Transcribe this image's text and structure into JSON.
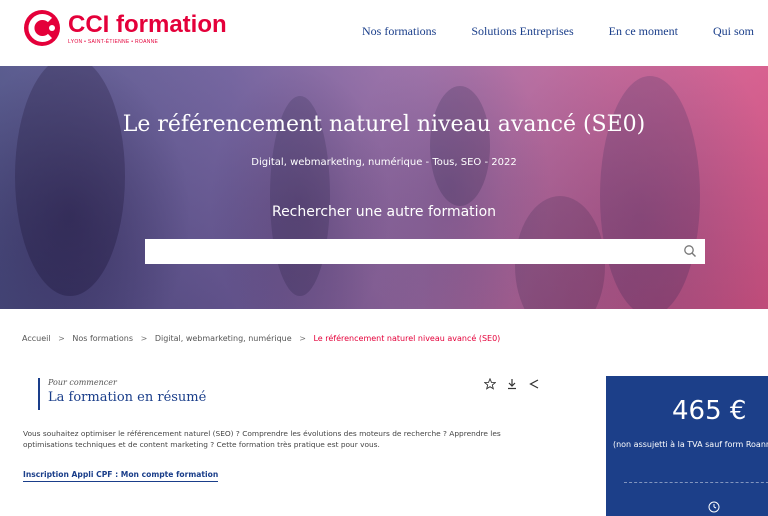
{
  "header": {
    "logo_title": "CCI formation",
    "logo_subtitle": "LYON • SAINT-ÉTIENNE • ROANNE",
    "nav": [
      "Nos formations",
      "Solutions Entreprises",
      "En ce moment",
      "Qui som"
    ]
  },
  "hero": {
    "title": "Le référencement naturel niveau avancé (SE0)",
    "subtitle": "Digital, webmarketing, numérique - Tous, SEO - 2022",
    "search_label": "Rechercher une autre formation",
    "search_placeholder": ""
  },
  "breadcrumb": {
    "items": [
      "Accueil",
      "Nos formations",
      "Digital, webmarketing, numérique"
    ],
    "current": "Le référencement naturel niveau avancé (SE0)",
    "separator": ">"
  },
  "summary": {
    "kicker": "Pour commencer",
    "title": "La formation en résumé",
    "description": "Vous souhaitez optimiser le référencement naturel (SEO)  ? Comprendre les évolutions des moteurs  de recherche ? Apprendre les optimisations techniques  et de content marketing ? Cette formation très pratique est pour vous.",
    "cpf_link": "Inscription Appli CPF : Mon compte formation"
  },
  "price_panel": {
    "price": "465 €",
    "note": "(non assujetti à la TVA sauf form Roanne)"
  },
  "icons": {
    "favorite": "star-icon",
    "download": "download-icon",
    "share": "share-icon",
    "search": "search-icon",
    "clock": "clock-icon"
  },
  "colors": {
    "brand_red": "#e4003a",
    "brand_blue": "#1a3e8a",
    "panel_blue": "#1c3f89"
  }
}
